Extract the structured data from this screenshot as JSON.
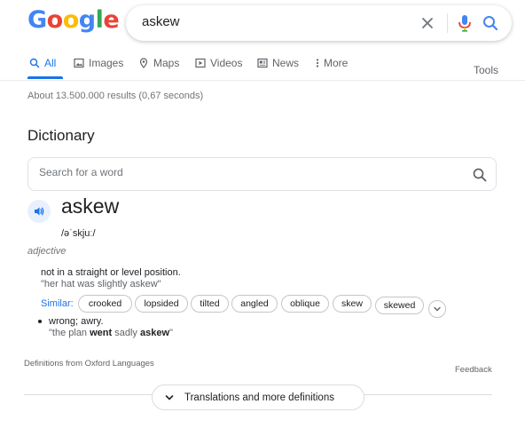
{
  "logo": {
    "letters": [
      "G",
      "o",
      "o",
      "g",
      "l",
      "e"
    ],
    "colors": [
      "#4285F4",
      "#EA4335",
      "#FBBC05",
      "#4285F4",
      "#34A853",
      "#EA4335"
    ]
  },
  "search": {
    "query": "askew"
  },
  "tabs": [
    {
      "label": "All",
      "icon": "search-icon",
      "active": true
    },
    {
      "label": "Images",
      "icon": "image-icon"
    },
    {
      "label": "Maps",
      "icon": "map-pin-icon"
    },
    {
      "label": "Videos",
      "icon": "video-icon"
    },
    {
      "label": "News",
      "icon": "news-icon"
    },
    {
      "label": "More",
      "icon": "more-vert-icon"
    }
  ],
  "tools_label": "Tools",
  "results_count": "About 13.500.000 results (0,67 seconds)",
  "dictionary": {
    "title": "Dictionary",
    "search_placeholder": "Search for a word",
    "word": "askew",
    "phonetic": "/əˈskjuː/",
    "part_of_speech": "adjective",
    "definitions": [
      {
        "text": "not in a straight or level position.",
        "example": "\"her hat was slightly askew\""
      },
      {
        "text": "wrong; awry.",
        "example_parts": [
          "\"the plan ",
          "went",
          " sadly ",
          "askew",
          "\""
        ]
      }
    ],
    "similar_label": "Similar:",
    "similar": [
      "crooked",
      "lopsided",
      "tilted",
      "angled",
      "oblique",
      "skew",
      "skewed"
    ],
    "source": "Definitions from Oxford Languages",
    "feedback": "Feedback",
    "more_button": "Translations and more definitions"
  },
  "colors": {
    "accent": "#1a73e8",
    "text": "#202124",
    "muted": "#70757a"
  }
}
